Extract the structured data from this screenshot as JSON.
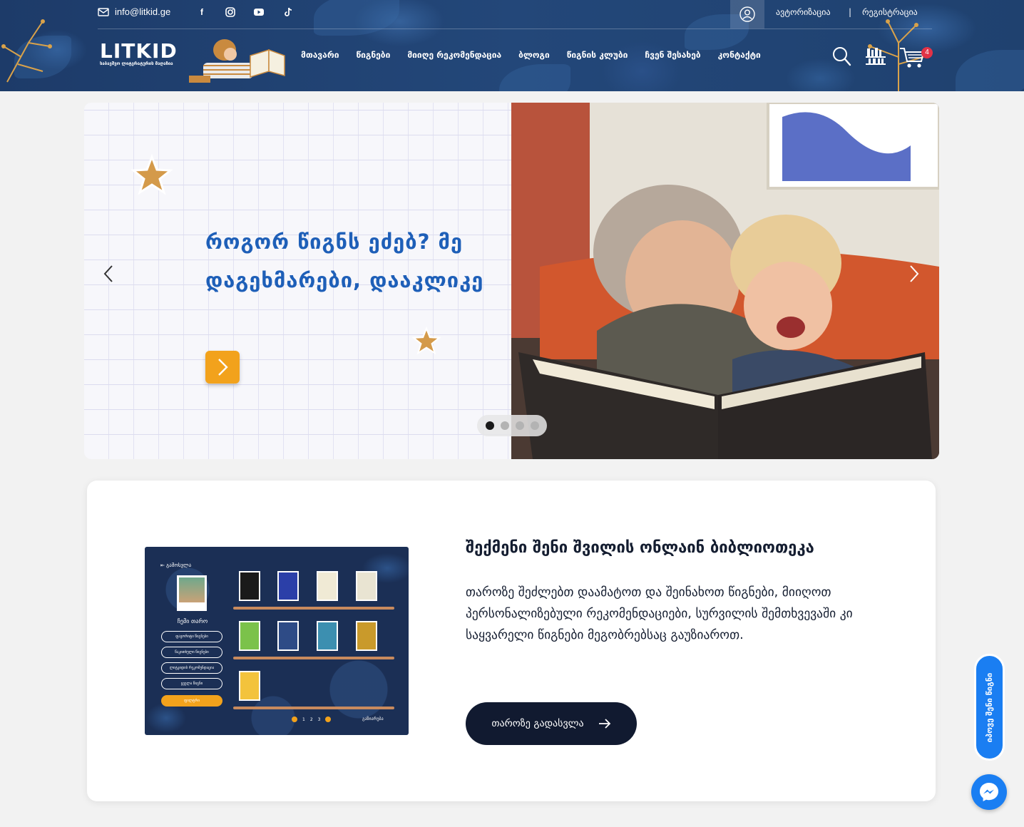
{
  "topbar": {
    "email": "info@litkid.ge",
    "social_icons": [
      "facebook-icon",
      "instagram-icon",
      "youtube-icon",
      "tiktok-icon"
    ],
    "login": "ავტორიზაცია",
    "separator": "|",
    "register": "რეგისტრაცია"
  },
  "logo": {
    "name": "LITKID",
    "subtitle": "საბავშვო ლიტერატურის მაღაზია"
  },
  "nav": {
    "items": [
      "მთავარი",
      "წიგნები",
      "მიიღე რეკომენდაცია",
      "ბლოგი",
      "წიგნის კლუბი",
      "ჩვენ შესახებ",
      "კონტაქტი"
    ]
  },
  "cart": {
    "count": "4"
  },
  "slider": {
    "title": "როგორ წიგნს ეძებ? მე დაგეხმარები, დააკლიკე",
    "slides_total": 4,
    "active_slide": 1
  },
  "library": {
    "title": "შექმენი შენი შვილის ონლაინ ბიბლიოთეკა",
    "body": "თაროზე შეძლებთ დაამატოთ და შეინახოთ წიგნები, მიიღოთ პერსონალიზებული რეკომენდაციები, სურვილის შემთხვევაში კი საყვარელი წიგნები მეგობრებსაც გაუზიაროთ.",
    "button": "თაროზე გადასვლა",
    "preview": {
      "back": "გამოსვლა",
      "shelf_label": "ჩემი თარო",
      "menu": [
        "ფავორიტი წიგნები",
        "წაკითხული წიგნები",
        "ლიტკიდის რეკომენდაცია",
        "ყველა წიგნი",
        "ფილტრი"
      ],
      "pages": [
        "1",
        "2",
        "3"
      ],
      "next": "გაზიარება"
    }
  },
  "floating": {
    "tab": "იპოვე შენი წიგნი",
    "messenger_icon": "messenger-icon"
  },
  "colors": {
    "header_bg": "#1f416f",
    "slide_title": "#1e5fb8",
    "cta_orange": "#f2a21c",
    "dark_button": "#111a30",
    "float_blue": "#1a7ef2",
    "badge_red": "#e23246"
  }
}
